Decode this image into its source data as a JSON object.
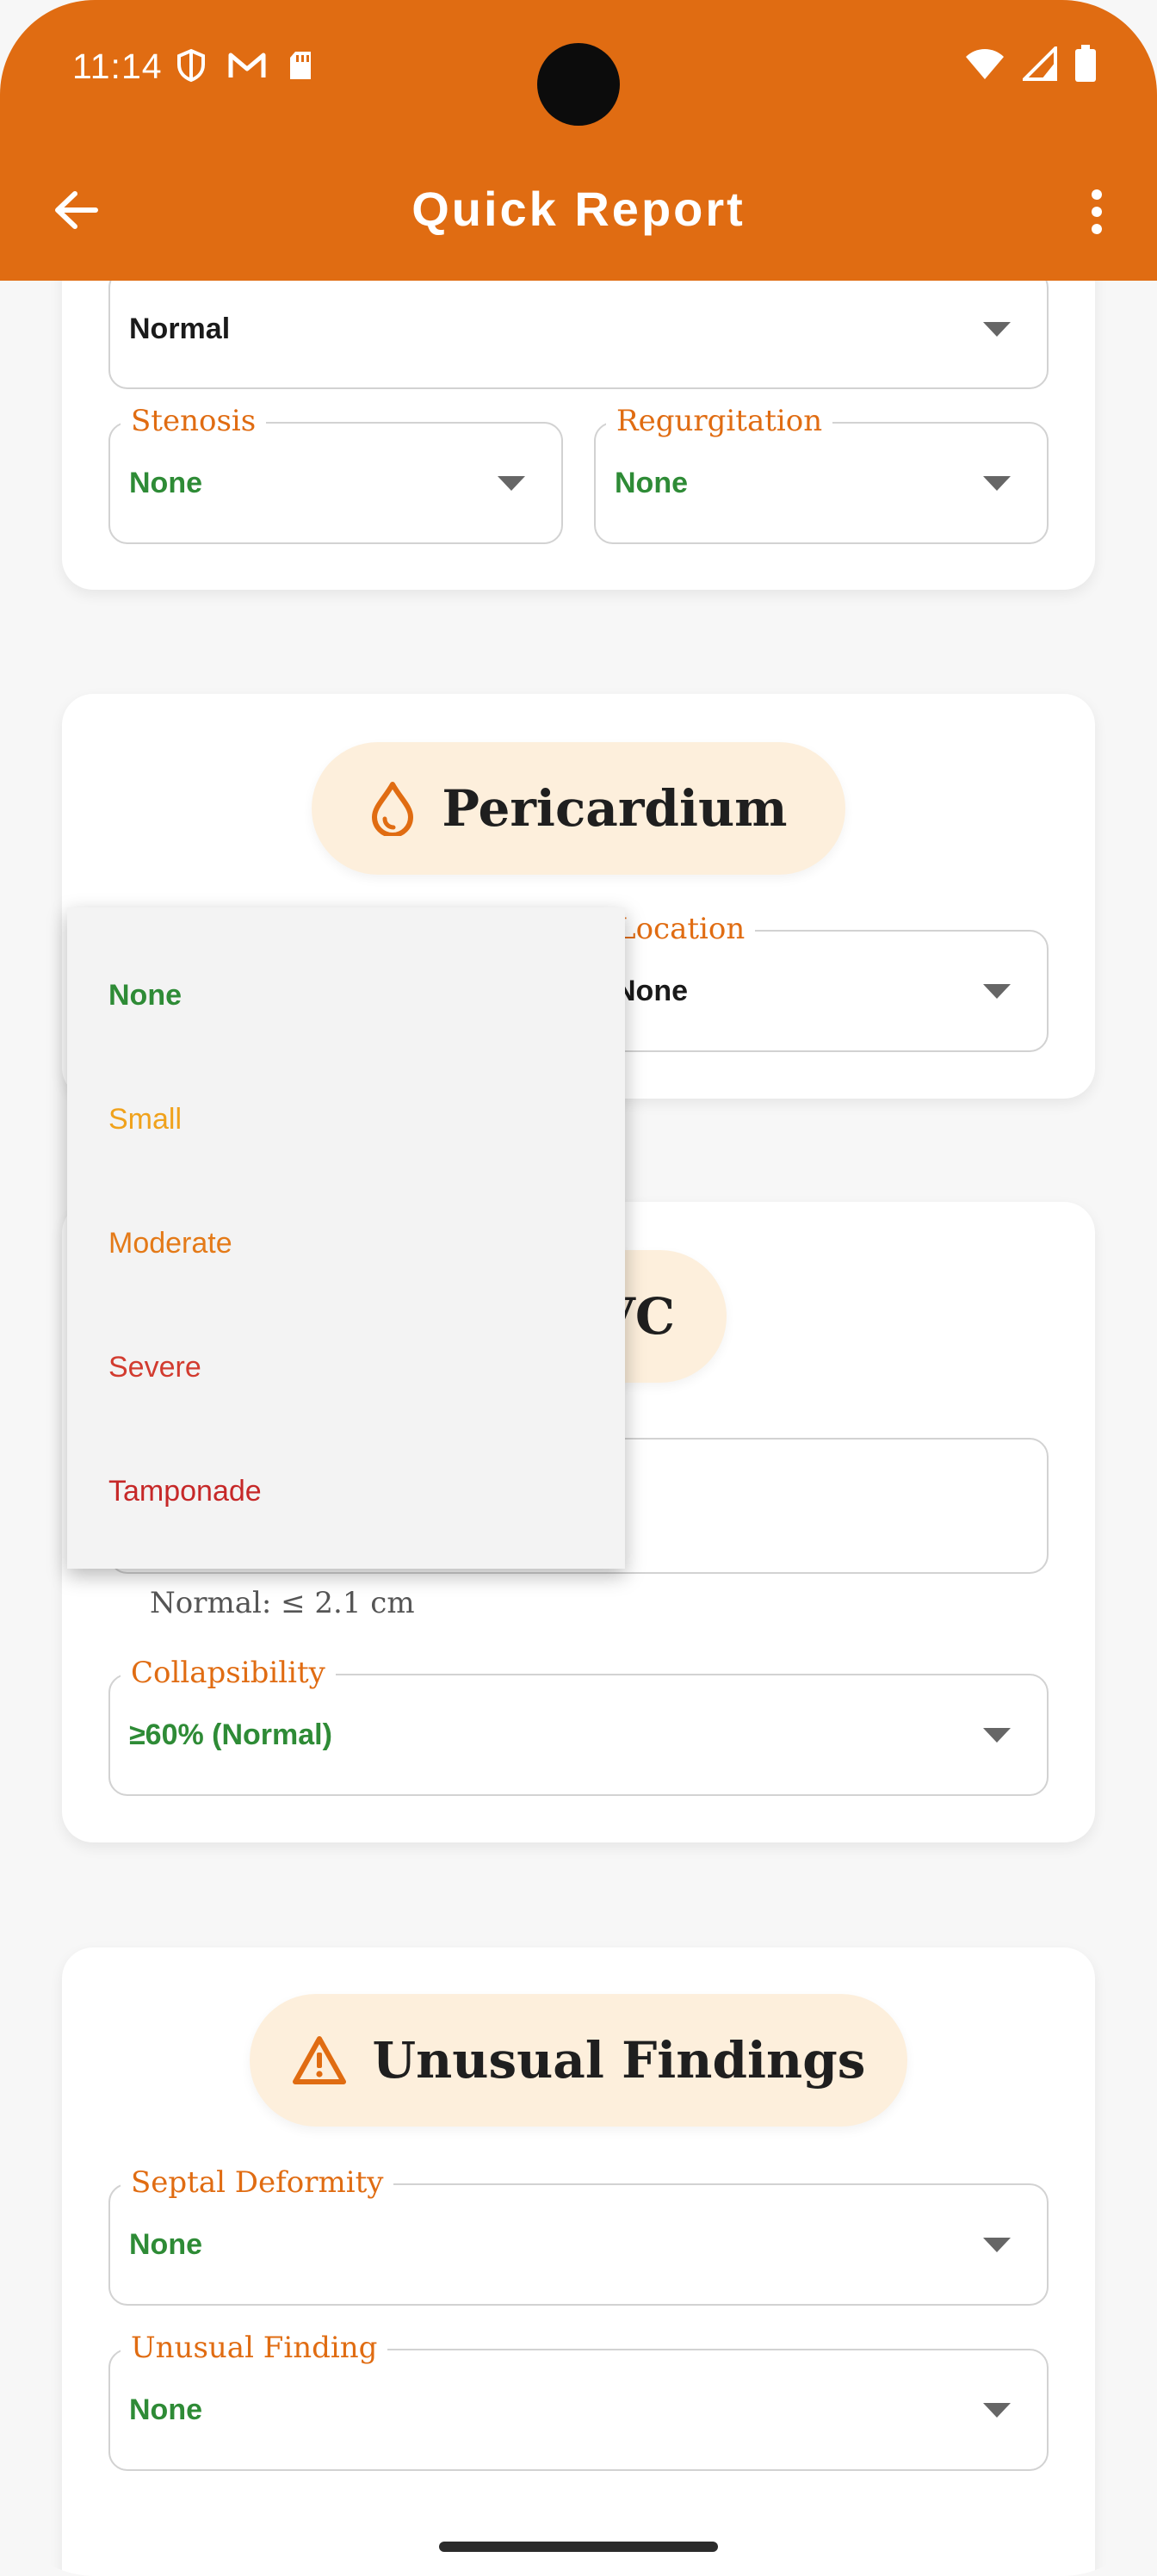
{
  "status_bar": {
    "time": "11:14"
  },
  "app_bar": {
    "title": "Quick Report",
    "back_icon": "arrow-left-icon",
    "menu_icon": "more-vert-icon"
  },
  "valve_section": {
    "top_select_value": "Normal",
    "stenosis": {
      "label": "Stenosis",
      "value": "None"
    },
    "regurgitation": {
      "label": "Regurgitation",
      "value": "None"
    }
  },
  "pericardium": {
    "title": "Pericardium",
    "icon": "droplet-icon",
    "location": {
      "label": "Location",
      "value": "None"
    }
  },
  "effusion_dropdown": {
    "options": [
      {
        "label": "None",
        "color": "#2e8b36"
      },
      {
        "label": "Small",
        "color": "#f0a21c"
      },
      {
        "label": "Moderate",
        "color": "#e47a18"
      },
      {
        "label": "Severe",
        "color": "#d23b2f"
      },
      {
        "label": "Tamponade",
        "color": "#c62828"
      }
    ]
  },
  "ivc": {
    "title_visible_fragment": "VC",
    "hint": "Normal: ≤ 2.1 cm",
    "collapsibility": {
      "label": "Collapsibility",
      "value": "≥60% (Normal)"
    }
  },
  "unusual_findings": {
    "title": "Unusual Findings",
    "icon": "warning-triangle-icon",
    "septal_deformity": {
      "label": "Septal Deformity",
      "value": "None"
    },
    "unusual_finding": {
      "label": "Unusual Finding",
      "value": "None"
    }
  },
  "colors": {
    "accent": "#e06c12",
    "pill_bg": "#fdefdc",
    "ok_green": "#2e8b36"
  }
}
